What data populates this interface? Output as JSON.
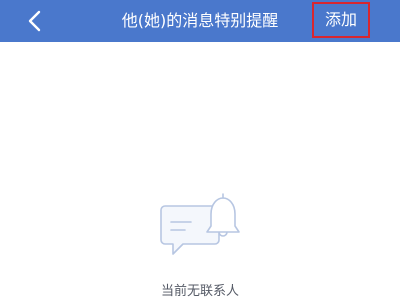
{
  "header": {
    "title": "他(她)的消息特别提醒",
    "add_label": "添加",
    "back_icon": "chevron-left-icon",
    "bar_color": "#4a78cc",
    "highlight_color": "#d9262f"
  },
  "empty_state": {
    "icon": "chat-bubble-bell-icon",
    "message": "当前无联系人"
  }
}
